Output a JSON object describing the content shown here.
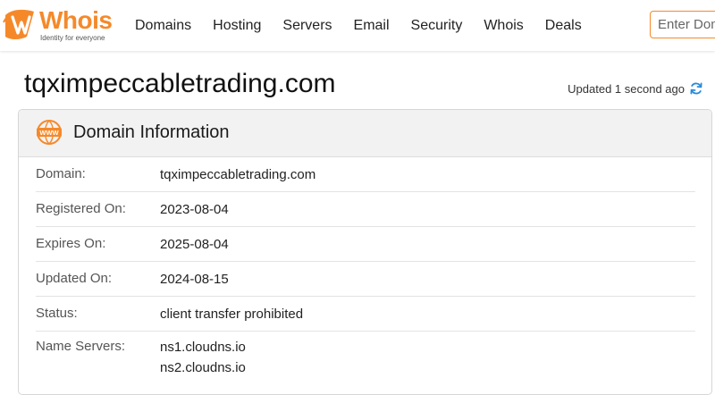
{
  "header": {
    "logo": {
      "word": "Whois",
      "tagline": "Identity for everyone"
    },
    "nav": [
      {
        "label": "Domains"
      },
      {
        "label": "Hosting"
      },
      {
        "label": "Servers"
      },
      {
        "label": "Email"
      },
      {
        "label": "Security"
      },
      {
        "label": "Whois"
      },
      {
        "label": "Deals"
      }
    ],
    "search": {
      "placeholder": "Enter Domain"
    }
  },
  "page": {
    "title": "tqximpeccabletrading.com",
    "updated_text": "Updated 1 second ago",
    "refresh_icon": "refresh-icon"
  },
  "card": {
    "icon": "www-icon",
    "title": "Domain Information",
    "rows": [
      {
        "label": "Domain:",
        "value": "tqximpeccabletrading.com"
      },
      {
        "label": "Registered On:",
        "value": "2023-08-04"
      },
      {
        "label": "Expires On:",
        "value": "2025-08-04"
      },
      {
        "label": "Updated On:",
        "value": "2024-08-15"
      },
      {
        "label": "Status:",
        "value": "client transfer prohibited"
      },
      {
        "label": "Name Servers:",
        "values": [
          "ns1.cloudns.io",
          "ns2.cloudns.io"
        ]
      }
    ]
  },
  "colors": {
    "brand": "#f5892a",
    "accent_blue": "#2b8bd8"
  }
}
